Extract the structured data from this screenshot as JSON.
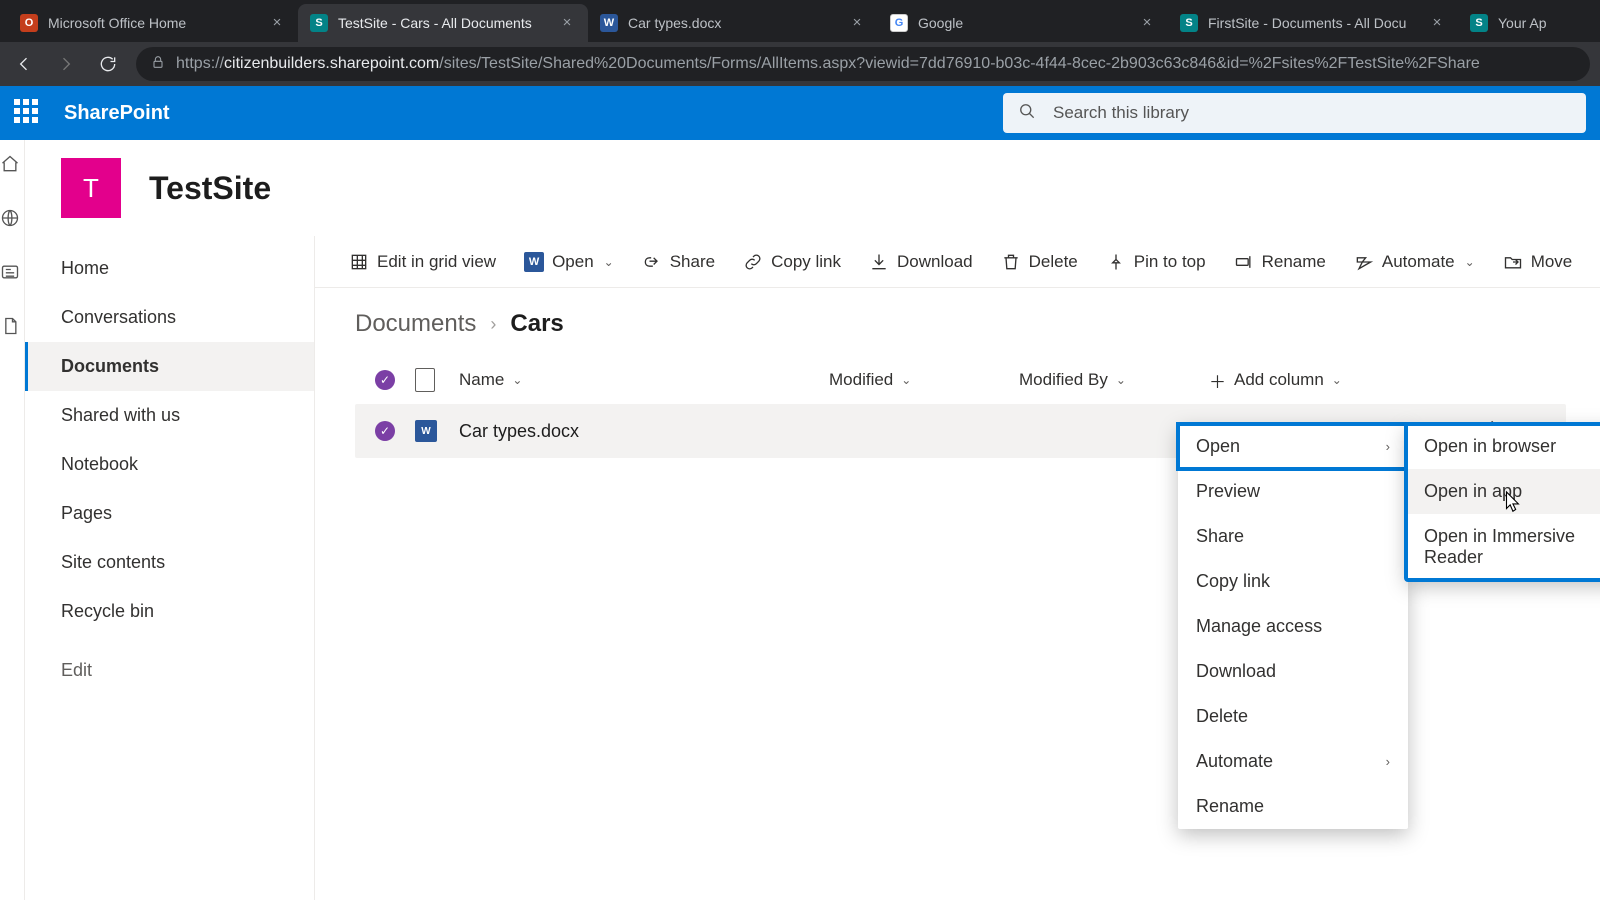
{
  "browser": {
    "tabs": [
      {
        "title": "Microsoft Office Home",
        "iconBg": "#c43e1c",
        "iconText": "O",
        "active": false
      },
      {
        "title": "TestSite - Cars - All Documents",
        "iconBg": "#038387",
        "iconText": "S",
        "active": true
      },
      {
        "title": "Car types.docx",
        "iconBg": "#2b579a",
        "iconText": "W",
        "active": false
      },
      {
        "title": "Google",
        "iconBg": "#fff",
        "iconText": "G",
        "active": false
      },
      {
        "title": "FirstSite - Documents - All Docu",
        "iconBg": "#038387",
        "iconText": "S",
        "active": false
      },
      {
        "title": "Your Ap",
        "iconBg": "#038387",
        "iconText": "S",
        "active": false
      }
    ],
    "url_prefix": "https://",
    "url_host": "citizenbuilders.sharepoint.com",
    "url_path": "/sites/TestSite/Shared%20Documents/Forms/AllItems.aspx?viewid=7dd76910-b03c-4f44-8cec-2b903c63c846&id=%2Fsites%2FTestSite%2FShare"
  },
  "suite": {
    "app": "SharePoint",
    "search_placeholder": "Search this library"
  },
  "site": {
    "logo_letter": "T",
    "name": "TestSite",
    "logo_bg": "#e3008c"
  },
  "leftnav": {
    "items": [
      "Home",
      "Conversations",
      "Documents",
      "Shared with us",
      "Notebook",
      "Pages",
      "Site contents",
      "Recycle bin"
    ],
    "selected_index": 2,
    "edit_label": "Edit"
  },
  "commandbar": {
    "edit_grid": "Edit in grid view",
    "open": "Open",
    "share": "Share",
    "copylink": "Copy link",
    "download": "Download",
    "delete": "Delete",
    "pin": "Pin to top",
    "rename": "Rename",
    "automate": "Automate",
    "move": "Move"
  },
  "breadcrumb": {
    "root": "Documents",
    "leaf": "Cars"
  },
  "columns": {
    "name": "Name",
    "modified": "Modified",
    "modified_by": "Modified By",
    "add": "Add column"
  },
  "rows": [
    {
      "name": "Car types.docx",
      "selected": true
    }
  ],
  "context_main": {
    "items": [
      "Open",
      "Preview",
      "Share",
      "Copy link",
      "Manage access",
      "Download",
      "Delete",
      "Automate",
      "Rename"
    ],
    "selected_index": 0,
    "has_submenu": [
      0,
      7
    ]
  },
  "context_sub": {
    "items": [
      "Open in browser",
      "Open in app",
      "Open in Immersive Reader"
    ],
    "hover_index": 1
  }
}
